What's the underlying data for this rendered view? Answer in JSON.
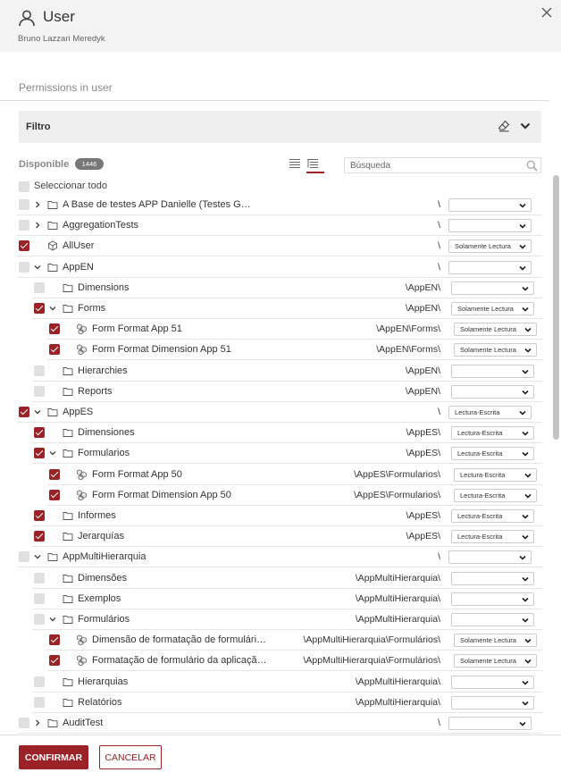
{
  "header": {
    "title": "User",
    "subtitle": "Bruno Lazzari Meredyk"
  },
  "section": {
    "title": "Permissions in user"
  },
  "filter": {
    "label": "Filtro"
  },
  "available": {
    "label": "Disponible",
    "count": "1446"
  },
  "search": {
    "placeholder": "Búsqueda",
    "value": ""
  },
  "select_all": {
    "label": "Seleccionar todo",
    "checked": false
  },
  "tree": [
    {
      "label": "A Base de testes APP Danielle (Testes Ge…",
      "path": "\\",
      "level": 0,
      "toggle": "collapsed",
      "icon": "folder-icon",
      "checked": false,
      "permission": ""
    },
    {
      "label": "AggregationTests",
      "path": "\\",
      "level": 0,
      "toggle": "collapsed",
      "icon": "folder-icon",
      "checked": false,
      "permission": ""
    },
    {
      "label": "AllUser",
      "path": "\\",
      "level": 0,
      "toggle": "none",
      "icon": "cube-icon",
      "checked": true,
      "permission": "Solamente Lectura"
    },
    {
      "label": "AppEN",
      "path": "\\",
      "level": 0,
      "toggle": "expanded",
      "icon": "folder-icon",
      "checked": false,
      "permission": ""
    },
    {
      "label": "Dimensions",
      "path": "\\AppEN\\",
      "level": 1,
      "toggle": "none",
      "icon": "folder-icon",
      "checked": false,
      "permission": ""
    },
    {
      "label": "Forms",
      "path": "\\AppEN\\",
      "level": 1,
      "toggle": "expanded",
      "icon": "folder-icon",
      "checked": true,
      "permission": "Solamente Lectura"
    },
    {
      "label": "Form Format App 51",
      "path": "\\AppEN\\Forms\\",
      "level": 2,
      "toggle": "none",
      "icon": "cubes-icon",
      "checked": true,
      "permission": "Solamente Lectura"
    },
    {
      "label": "Form Format Dimension App 51",
      "path": "\\AppEN\\Forms\\",
      "level": 2,
      "toggle": "none",
      "icon": "cubes-icon",
      "checked": true,
      "permission": "Solamente Lectura"
    },
    {
      "label": "Hierarchies",
      "path": "\\AppEN\\",
      "level": 1,
      "toggle": "none",
      "icon": "folder-icon",
      "checked": false,
      "permission": ""
    },
    {
      "label": "Reports",
      "path": "\\AppEN\\",
      "level": 1,
      "toggle": "none",
      "icon": "folder-icon",
      "checked": false,
      "permission": ""
    },
    {
      "label": "AppES",
      "path": "\\",
      "level": 0,
      "toggle": "expanded",
      "icon": "folder-icon",
      "checked": true,
      "permission": "Lectura-Escrita"
    },
    {
      "label": "Dimensiones",
      "path": "\\AppES\\",
      "level": 1,
      "toggle": "none",
      "icon": "folder-icon",
      "checked": true,
      "permission": "Lectura-Escrita"
    },
    {
      "label": "Formularios",
      "path": "\\AppES\\",
      "level": 1,
      "toggle": "expanded",
      "icon": "folder-icon",
      "checked": true,
      "permission": "Lectura-Escrita"
    },
    {
      "label": "Form Format App 50",
      "path": "\\AppES\\Formularios\\",
      "level": 2,
      "toggle": "none",
      "icon": "cubes-icon",
      "checked": true,
      "permission": "Lectura-Escrita"
    },
    {
      "label": "Form Format Dimension App 50",
      "path": "\\AppES\\Formularios\\",
      "level": 2,
      "toggle": "none",
      "icon": "cubes-icon",
      "checked": true,
      "permission": "Lectura-Escrita"
    },
    {
      "label": "Informes",
      "path": "\\AppES\\",
      "level": 1,
      "toggle": "none",
      "icon": "folder-icon",
      "checked": true,
      "permission": "Lectura-Escrita"
    },
    {
      "label": "Jerarquías",
      "path": "\\AppES\\",
      "level": 1,
      "toggle": "none",
      "icon": "folder-icon",
      "checked": true,
      "permission": "Lectura-Escrita"
    },
    {
      "label": "AppMultiHierarquia",
      "path": "\\",
      "level": 0,
      "toggle": "expanded",
      "icon": "folder-icon",
      "checked": false,
      "permission": ""
    },
    {
      "label": "Dimensões",
      "path": "\\AppMultiHierarquia\\",
      "level": 1,
      "toggle": "none",
      "icon": "folder-icon",
      "checked": false,
      "permission": ""
    },
    {
      "label": "Exemplos",
      "path": "\\AppMultiHierarquia\\",
      "level": 1,
      "toggle": "none",
      "icon": "folder-icon",
      "checked": false,
      "permission": ""
    },
    {
      "label": "Formulários",
      "path": "\\AppMultiHierarquia\\",
      "level": 1,
      "toggle": "expanded",
      "icon": "folder-icon",
      "checked": false,
      "permission": ""
    },
    {
      "label": "Dimensão de formatação de formulári…",
      "path": "\\AppMultiHierarquia\\Formulários\\",
      "level": 2,
      "toggle": "none",
      "icon": "cubes-icon",
      "checked": true,
      "permission": "Solamente Lectura"
    },
    {
      "label": "Formatação de formulário da aplicaçã…",
      "path": "\\AppMultiHierarquia\\Formulários\\",
      "level": 2,
      "toggle": "none",
      "icon": "cubes-icon",
      "checked": true,
      "permission": "Solamente Lectura"
    },
    {
      "label": "Hierarquias",
      "path": "\\AppMultiHierarquia\\",
      "level": 1,
      "toggle": "none",
      "icon": "folder-icon",
      "checked": false,
      "permission": ""
    },
    {
      "label": "Relatórios",
      "path": "\\AppMultiHierarquia\\",
      "level": 1,
      "toggle": "none",
      "icon": "folder-icon",
      "checked": false,
      "permission": ""
    },
    {
      "label": "AuditTest",
      "path": "\\",
      "level": 0,
      "toggle": "collapsed",
      "icon": "folder-icon",
      "checked": false,
      "permission": ""
    }
  ],
  "footer": {
    "confirm_label": "CONFIRMAR",
    "cancel_label": "CANCELAR"
  },
  "colors": {
    "accent": "#9b2226",
    "header_bg": "#f3f3f3",
    "filter_bg": "#efefef",
    "checkbox_off": "#e0e0e0"
  }
}
